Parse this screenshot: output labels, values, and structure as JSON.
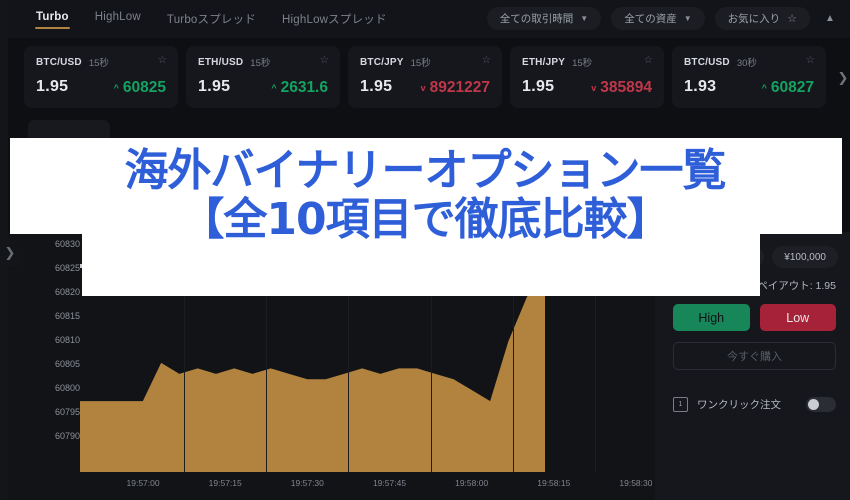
{
  "app": {
    "bg": "#0e0f12",
    "accent": "#b08342",
    "up_color": "#15a362",
    "down_color": "#c0374a"
  },
  "topbar": {
    "tabs": [
      {
        "label": "Turbo",
        "active": true
      },
      {
        "label": "HighLow",
        "active": false
      },
      {
        "label": "Turboスプレッド",
        "active": false
      },
      {
        "label": "HighLowスプレッド",
        "active": false
      }
    ],
    "filters": [
      {
        "label": "全ての取引時間",
        "icon": "chevron-down-icon"
      },
      {
        "label": "全ての資産",
        "icon": "chevron-down-icon"
      },
      {
        "label": "お気に入り",
        "icon": "star-icon"
      }
    ],
    "collapse_icon": "chevron-up-icon"
  },
  "asset_cards": [
    {
      "symbol": "BTC/USD",
      "duration": "15秒",
      "payout": "1.95",
      "price": "60825",
      "direction": "up",
      "arrow": "^",
      "star": "☆"
    },
    {
      "symbol": "ETH/USD",
      "duration": "15秒",
      "payout": "1.95",
      "price": "2631.6",
      "direction": "up",
      "arrow": "^",
      "star": "☆"
    },
    {
      "symbol": "BTC/JPY",
      "duration": "15秒",
      "payout": "1.95",
      "price": "8921227",
      "direction": "down",
      "arrow": "v",
      "star": "☆"
    },
    {
      "symbol": "ETH/JPY",
      "duration": "15秒",
      "payout": "1.95",
      "price": "385894",
      "direction": "down",
      "arrow": "v",
      "star": "☆"
    },
    {
      "symbol": "BTC/USD",
      "duration": "30秒",
      "payout": "1.93",
      "price": "60827",
      "direction": "up",
      "arrow": "^",
      "star": "☆"
    }
  ],
  "cards_next_icon": "chevron-right-icon",
  "rail": {
    "expand_icon": "chevron-right-icon"
  },
  "chart_data": {
    "type": "area",
    "title": "",
    "xlabel": "",
    "ylabel": "",
    "grid": true,
    "legend": false,
    "series_color": "#b2833f",
    "ylim": [
      60788,
      60832
    ],
    "yticks": [
      "60830",
      "60825",
      "60820",
      "60815",
      "60810",
      "60805",
      "60800",
      "60795",
      "60790"
    ],
    "ytick_values": [
      60830,
      60825,
      60820,
      60815,
      60810,
      60805,
      60800,
      60795,
      60790
    ],
    "xticks": [
      "19:57:00",
      "19:57:15",
      "19:57:30",
      "19:57:45",
      "19:58:00",
      "19:58:15",
      "19:58:30"
    ],
    "current_price_line": 60825,
    "x": [
      "19:57:00",
      "19:57:03",
      "19:57:06",
      "19:57:09",
      "19:57:12",
      "19:57:15",
      "19:57:18",
      "19:57:21",
      "19:57:24",
      "19:57:27",
      "19:57:30",
      "19:57:33",
      "19:57:36",
      "19:57:39",
      "19:57:42",
      "19:57:45",
      "19:57:48",
      "19:57:51",
      "19:57:54",
      "19:57:57",
      "19:58:00",
      "19:58:03",
      "19:58:06",
      "19:58:09",
      "19:58:12",
      "19:58:15"
    ],
    "values": [
      60801,
      60801,
      60801,
      60801,
      60808,
      60806,
      60807,
      60806,
      60807,
      60806,
      60807,
      60806,
      60805,
      60805,
      60806,
      60807,
      60806,
      60807,
      60807,
      60806,
      60805,
      60803,
      60801,
      60812,
      60820,
      60826
    ]
  },
  "trade_panel": {
    "amount_chip_partial": "0",
    "amount": "¥100,000",
    "payout_label": "ペイアウト: 1.95",
    "high_label": "High",
    "low_label": "Low",
    "buy_label": "今すぐ購入",
    "oneclick_label": "ワンクリック注文",
    "oneclick_icon": "one-click-icon",
    "oneclick_on": false
  },
  "banner": {
    "line1": "海外バイナリーオプション一覧",
    "line2": "【全10項目で徹底比較】",
    "text_color": "#2f5fd8",
    "bg_color": "#ffffff"
  }
}
